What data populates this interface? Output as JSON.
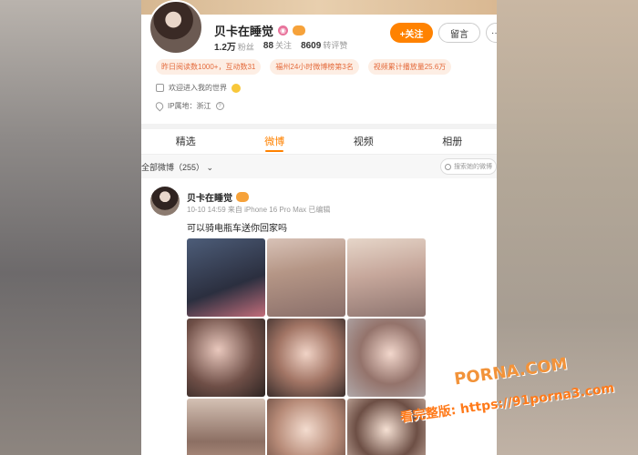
{
  "profile": {
    "name": "贝卡在睡觉",
    "stats": [
      {
        "value": "1.2万",
        "label": "粉丝"
      },
      {
        "value": "88",
        "label": "关注"
      },
      {
        "value": "8609",
        "label": "转评赞"
      }
    ],
    "follow_label": "+关注",
    "message_label": "留言",
    "more_label": "···",
    "tags": [
      "昨日阅读数1000+，互动数31",
      "福州24小时微博榜第3名",
      "视频累计播放量25.6万"
    ],
    "bio": "欢迎进入我的世界",
    "ip_location": "IP属地：浙江"
  },
  "tabs": [
    {
      "label": "精选",
      "active": false
    },
    {
      "label": "微博",
      "active": true
    },
    {
      "label": "视频",
      "active": false
    },
    {
      "label": "相册",
      "active": false
    }
  ],
  "filter": {
    "label": "全部微博（255）",
    "search_placeholder": "搜索她的微博"
  },
  "post": {
    "author": "贝卡在睡觉",
    "meta": "10-10 14:59  来自 iPhone 16 Pro Max 已编辑",
    "text": "可以骑电瓶车送你回家吗",
    "image_count": 9
  },
  "watermark": {
    "line1": "PORNA.COM",
    "line2": "看完整版: https://91porna3.com"
  },
  "colors": {
    "accent": "#ff8200",
    "tag_bg": "#fdeee4",
    "tag_text": "#e46b3c"
  }
}
